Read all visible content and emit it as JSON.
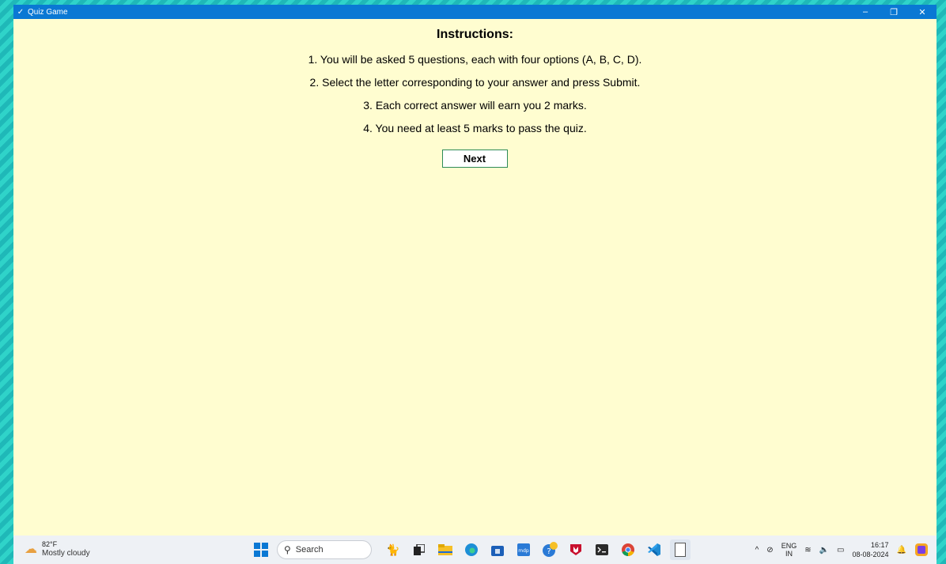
{
  "window": {
    "title": "Quiz Game",
    "controls": {
      "minimize": "–",
      "restore": "❐",
      "close": "✕"
    }
  },
  "instructions": {
    "heading": "Instructions:",
    "lines": [
      "1. You will be asked 5 questions, each with four options (A, B, C, D).",
      "2. Select the letter corresponding to your answer and press Submit.",
      "3. Each correct answer will earn you 2 marks.",
      "4. You need at least 5 marks to pass the quiz."
    ],
    "next_label": "Next"
  },
  "taskbar": {
    "weather": {
      "temp": "82°F",
      "condition": "Mostly cloudy"
    },
    "search_placeholder": "Search",
    "language": {
      "line1": "ENG",
      "line2": "IN"
    },
    "clock": {
      "time": "16:17",
      "date": "08-08-2024"
    },
    "icons": [
      "windows-start-icon",
      "cat-widget-icon",
      "task-view-icon",
      "file-explorer-icon",
      "edge-icon",
      "store-icon",
      "mdp-icon",
      "help-icon",
      "mcafee-icon",
      "terminal-icon",
      "chrome-icon",
      "vscode-icon",
      "notepad-icon"
    ]
  }
}
